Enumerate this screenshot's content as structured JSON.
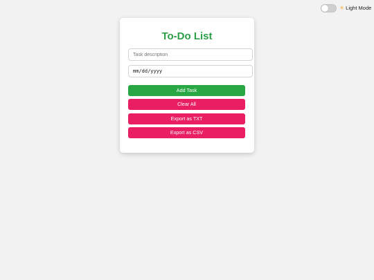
{
  "theme": {
    "icon": "sun-icon",
    "icon_glyph": "☀",
    "label": "Light Mode"
  },
  "app": {
    "title": "To-Do List"
  },
  "form": {
    "task_placeholder": "Task description",
    "task_value": "",
    "date_placeholder": "mm/dd/yyyy"
  },
  "buttons": {
    "add": "Add Task",
    "clear": "Clear All",
    "export_txt": "Export as TXT",
    "export_csv": "Export as CSV"
  },
  "colors": {
    "accent_green": "#29a745",
    "accent_pink": "#e91e63",
    "title_green": "#2b9e48"
  }
}
